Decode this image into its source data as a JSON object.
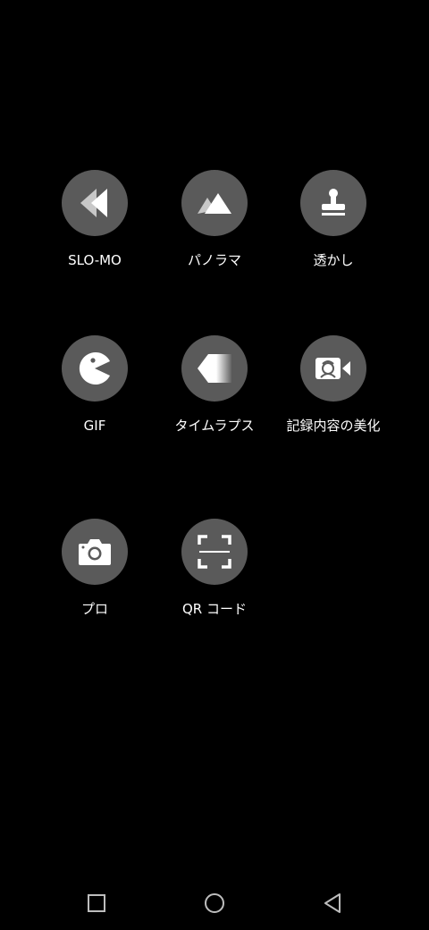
{
  "modes": {
    "slomo": {
      "label": "SLO-MO",
      "icon": "rewind-icon"
    },
    "panorama": {
      "label": "パノラマ",
      "icon": "mountain-icon"
    },
    "watermark": {
      "label": "透かし",
      "icon": "stamp-icon"
    },
    "gif": {
      "label": "GIF",
      "icon": "pacman-icon"
    },
    "timelapse": {
      "label": "タイムラプス",
      "icon": "timelapse-icon"
    },
    "beautify": {
      "label": "記録内容の美化",
      "icon": "beauty-video-icon"
    },
    "pro": {
      "label": "プロ",
      "icon": "camera-icon"
    },
    "qr": {
      "label": "QR コード",
      "icon": "qr-scan-icon"
    }
  },
  "nav": {
    "recents": "square-icon",
    "home": "circle-icon",
    "back": "triangle-back-icon"
  },
  "colors": {
    "background": "#000000",
    "button_circle": "#5a5a5a",
    "icon": "#ffffff",
    "nav_icon": "#bdbdbd"
  }
}
